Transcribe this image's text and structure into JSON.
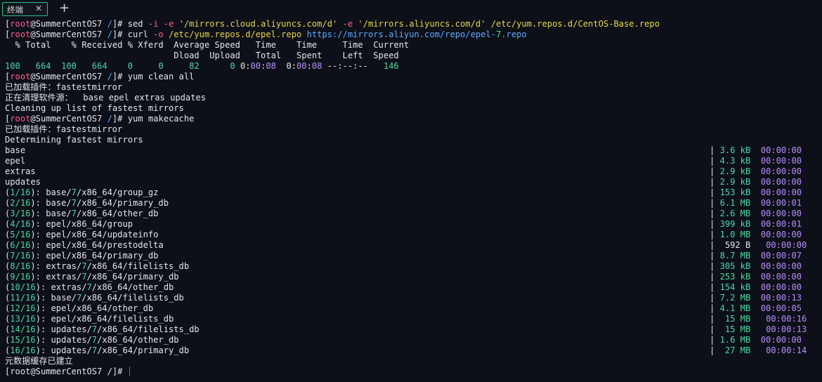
{
  "tab": {
    "title": "终端",
    "close_glyph": "✕",
    "new_tab_glyph": "+"
  },
  "colors": {
    "background": "#0d1018",
    "tab_border": "#2ec27e",
    "prompt_bracket": "#ff5c8a",
    "path": "#5ea8ff",
    "string": "#e8d44d",
    "number": "#4fd6a2",
    "time": "#b98cff",
    "cursor": "#e0406a"
  },
  "terminal": {
    "lines": [
      {
        "segs": [
          [
            "[",
            "d"
          ],
          [
            "root",
            "r"
          ],
          [
            "@SummerCentOS7 ",
            "d"
          ],
          [
            "/",
            "b"
          ],
          [
            "]# ",
            "d"
          ],
          [
            "sed ",
            "d"
          ],
          [
            "-i -e ",
            "r"
          ],
          [
            "'/mirrors.cloud.aliyuncs.com/d'",
            "y"
          ],
          [
            " ",
            "d"
          ],
          [
            "-e ",
            "r"
          ],
          [
            "'/mirrors.aliyuncs.com/d'",
            "y"
          ],
          [
            " ",
            "d"
          ],
          [
            "/etc/yum.repos.d/CentOS-Base.repo",
            "y"
          ]
        ]
      },
      {
        "segs": [
          [
            "[",
            "d"
          ],
          [
            "root",
            "r"
          ],
          [
            "@SummerCentOS7 ",
            "d"
          ],
          [
            "/",
            "b"
          ],
          [
            "]# ",
            "d"
          ],
          [
            "curl ",
            "d"
          ],
          [
            "-o ",
            "r"
          ],
          [
            "/etc/yum.repos.d/epel.repo",
            "y"
          ],
          [
            " ",
            "d"
          ],
          [
            "https://mirrors.aliyun.com/repo/epel-",
            "b"
          ],
          [
            "7",
            "g"
          ],
          [
            ".repo",
            "b"
          ]
        ]
      },
      {
        "segs": [
          [
            "  % Total    % Received % Xferd  Average Speed   Time    Time     Time  Current",
            "d"
          ]
        ]
      },
      {
        "segs": [
          [
            "                                 Dload  Upload   Total   Spent    Left  Speed",
            "d"
          ]
        ]
      },
      {
        "segs": [
          [
            "100   664  100   664    0     0     82      0 ",
            "g"
          ],
          [
            "0",
            "d"
          ],
          [
            ":",
            "d"
          ],
          [
            "00",
            "p"
          ],
          [
            ":",
            "d"
          ],
          [
            "08",
            "p"
          ],
          [
            "  ",
            "d"
          ],
          [
            "0",
            "d"
          ],
          [
            ":",
            "d"
          ],
          [
            "00",
            "p"
          ],
          [
            ":",
            "d"
          ],
          [
            "08",
            "p"
          ],
          [
            " --:--:--   ",
            "d"
          ],
          [
            "146",
            "g"
          ]
        ]
      },
      {
        "segs": [
          [
            "[",
            "d"
          ],
          [
            "root",
            "r"
          ],
          [
            "@SummerCentOS7 ",
            "d"
          ],
          [
            "/",
            "b"
          ],
          [
            "]# ",
            "d"
          ],
          [
            "yum clean all",
            "d"
          ]
        ]
      },
      {
        "segs": [
          [
            "已加载插件：fastestmirror",
            "d"
          ]
        ]
      },
      {
        "segs": [
          [
            "正在清理软件源：  base epel extras updates",
            "d"
          ]
        ]
      },
      {
        "segs": [
          [
            "Cleaning up list of fastest mirrors",
            "d"
          ]
        ]
      },
      {
        "segs": [
          [
            "[",
            "d"
          ],
          [
            "root",
            "r"
          ],
          [
            "@SummerCentOS7 ",
            "d"
          ],
          [
            "/",
            "b"
          ],
          [
            "]# ",
            "d"
          ],
          [
            "yum makecache",
            "d"
          ]
        ]
      },
      {
        "segs": [
          [
            "已加载插件：fastestmirror",
            "d"
          ]
        ]
      },
      {
        "segs": [
          [
            "Determining fastest mirrors",
            "d"
          ]
        ]
      },
      {
        "segs": [
          [
            "base",
            "d"
          ]
        ],
        "right": [
          [
            "| ",
            "d"
          ],
          [
            "3.6 kB",
            "g"
          ],
          [
            "  ",
            "d"
          ],
          [
            "00:00:00",
            "p"
          ]
        ]
      },
      {
        "segs": [
          [
            "epel",
            "d"
          ]
        ],
        "right": [
          [
            "| ",
            "d"
          ],
          [
            "4.3 kB",
            "g"
          ],
          [
            "  ",
            "d"
          ],
          [
            "00:00:00",
            "p"
          ]
        ]
      },
      {
        "segs": [
          [
            "extras",
            "d"
          ]
        ],
        "right": [
          [
            "| ",
            "d"
          ],
          [
            "2.9 kB",
            "g"
          ],
          [
            "  ",
            "d"
          ],
          [
            "00:00:00",
            "p"
          ]
        ]
      },
      {
        "segs": [
          [
            "updates",
            "d"
          ]
        ],
        "right": [
          [
            "| ",
            "d"
          ],
          [
            "2.9 kB",
            "g"
          ],
          [
            "  ",
            "d"
          ],
          [
            "00:00:00",
            "p"
          ]
        ]
      },
      {
        "segs": [
          [
            "(",
            "d"
          ],
          [
            "1/16",
            "g"
          ],
          [
            "): base/",
            "d"
          ],
          [
            "7",
            "g"
          ],
          [
            "/x86_64/group_gz",
            "d"
          ]
        ],
        "right": [
          [
            "| ",
            "d"
          ],
          [
            "153 kB",
            "g"
          ],
          [
            "  ",
            "d"
          ],
          [
            "00:00:00",
            "p"
          ]
        ]
      },
      {
        "segs": [
          [
            "(",
            "d"
          ],
          [
            "2/16",
            "g"
          ],
          [
            "): base/",
            "d"
          ],
          [
            "7",
            "g"
          ],
          [
            "/x86_64/primary_db",
            "d"
          ]
        ],
        "right": [
          [
            "| ",
            "d"
          ],
          [
            "6.1 MB",
            "g"
          ],
          [
            "  ",
            "d"
          ],
          [
            "00:00:01",
            "p"
          ]
        ]
      },
      {
        "segs": [
          [
            "(",
            "d"
          ],
          [
            "3/16",
            "g"
          ],
          [
            "): base/",
            "d"
          ],
          [
            "7",
            "g"
          ],
          [
            "/x86_64/other_db",
            "d"
          ]
        ],
        "right": [
          [
            "| ",
            "d"
          ],
          [
            "2.6 MB",
            "g"
          ],
          [
            "  ",
            "d"
          ],
          [
            "00:00:00",
            "p"
          ]
        ]
      },
      {
        "segs": [
          [
            "(",
            "d"
          ],
          [
            "4/16",
            "g"
          ],
          [
            "): epel/x86_64/group",
            "d"
          ]
        ],
        "right": [
          [
            "| ",
            "d"
          ],
          [
            "399 kB",
            "g"
          ],
          [
            "  ",
            "d"
          ],
          [
            "00:00:01",
            "p"
          ]
        ]
      },
      {
        "segs": [
          [
            "(",
            "d"
          ],
          [
            "5/16",
            "g"
          ],
          [
            "): epel/x86_64/updateinfo",
            "d"
          ]
        ],
        "right": [
          [
            "| ",
            "d"
          ],
          [
            "1.0 MB",
            "g"
          ],
          [
            "  ",
            "d"
          ],
          [
            "00:00:00",
            "p"
          ]
        ]
      },
      {
        "segs": [
          [
            "(",
            "d"
          ],
          [
            "6/16",
            "g"
          ],
          [
            "): epel/x86_64/prestodelta",
            "d"
          ]
        ],
        "right": [
          [
            "|  ",
            "d"
          ],
          [
            "592 B ",
            "d"
          ],
          [
            "  ",
            "d"
          ],
          [
            "00:00:00",
            "p"
          ]
        ]
      },
      {
        "segs": [
          [
            "(",
            "d"
          ],
          [
            "7/16",
            "g"
          ],
          [
            "): epel/x86_64/primary_db",
            "d"
          ]
        ],
        "right": [
          [
            "| ",
            "d"
          ],
          [
            "8.7 MB",
            "g"
          ],
          [
            "  ",
            "d"
          ],
          [
            "00:00:07",
            "p"
          ]
        ]
      },
      {
        "segs": [
          [
            "(",
            "d"
          ],
          [
            "8/16",
            "g"
          ],
          [
            "): extras/",
            "d"
          ],
          [
            "7",
            "g"
          ],
          [
            "/x86_64/filelists_db",
            "d"
          ]
        ],
        "right": [
          [
            "| ",
            "d"
          ],
          [
            "305 kB",
            "g"
          ],
          [
            "  ",
            "d"
          ],
          [
            "00:00:00",
            "p"
          ]
        ]
      },
      {
        "segs": [
          [
            "(",
            "d"
          ],
          [
            "9/16",
            "g"
          ],
          [
            "): extras/",
            "d"
          ],
          [
            "7",
            "g"
          ],
          [
            "/x86_64/primary_db",
            "d"
          ]
        ],
        "right": [
          [
            "| ",
            "d"
          ],
          [
            "253 kB",
            "g"
          ],
          [
            "  ",
            "d"
          ],
          [
            "00:00:00",
            "p"
          ]
        ]
      },
      {
        "segs": [
          [
            "(",
            "d"
          ],
          [
            "10/16",
            "g"
          ],
          [
            "): extras/",
            "d"
          ],
          [
            "7",
            "g"
          ],
          [
            "/x86_64/other_db",
            "d"
          ]
        ],
        "right": [
          [
            "| ",
            "d"
          ],
          [
            "154 kB",
            "g"
          ],
          [
            "  ",
            "d"
          ],
          [
            "00:00:00",
            "p"
          ]
        ]
      },
      {
        "segs": [
          [
            "(",
            "d"
          ],
          [
            "11/16",
            "g"
          ],
          [
            "): base/",
            "d"
          ],
          [
            "7",
            "g"
          ],
          [
            "/x86_64/filelists_db",
            "d"
          ]
        ],
        "right": [
          [
            "| ",
            "d"
          ],
          [
            "7.2 MB",
            "g"
          ],
          [
            "  ",
            "d"
          ],
          [
            "00:00:13",
            "p"
          ]
        ]
      },
      {
        "segs": [
          [
            "(",
            "d"
          ],
          [
            "12/16",
            "g"
          ],
          [
            "): epel/x86_64/other_db",
            "d"
          ]
        ],
        "right": [
          [
            "| ",
            "d"
          ],
          [
            "4.1 MB",
            "g"
          ],
          [
            "  ",
            "d"
          ],
          [
            "00:00:05",
            "p"
          ]
        ]
      },
      {
        "segs": [
          [
            "(",
            "d"
          ],
          [
            "13/16",
            "g"
          ],
          [
            "): epel/x86_64/filelists_db",
            "d"
          ]
        ],
        "right": [
          [
            "|  ",
            "d"
          ],
          [
            "15 MB",
            "g"
          ],
          [
            "   ",
            "d"
          ],
          [
            "00:00:16",
            "p"
          ]
        ]
      },
      {
        "segs": [
          [
            "(",
            "d"
          ],
          [
            "14/16",
            "g"
          ],
          [
            "): updates/",
            "d"
          ],
          [
            "7",
            "g"
          ],
          [
            "/x86_64/filelists_db",
            "d"
          ]
        ],
        "right": [
          [
            "|  ",
            "d"
          ],
          [
            "15 MB",
            "g"
          ],
          [
            "   ",
            "d"
          ],
          [
            "00:00:13",
            "p"
          ]
        ]
      },
      {
        "segs": [
          [
            "(",
            "d"
          ],
          [
            "15/16",
            "g"
          ],
          [
            "): updates/",
            "d"
          ],
          [
            "7",
            "g"
          ],
          [
            "/x86_64/other_db",
            "d"
          ]
        ],
        "right": [
          [
            "| ",
            "d"
          ],
          [
            "1.6 MB",
            "g"
          ],
          [
            "  ",
            "d"
          ],
          [
            "00:00:00",
            "p"
          ]
        ]
      },
      {
        "segs": [
          [
            "(",
            "d"
          ],
          [
            "16/16",
            "g"
          ],
          [
            "): updates/",
            "d"
          ],
          [
            "7",
            "g"
          ],
          [
            "/x86_64/primary_db",
            "d"
          ]
        ],
        "right": [
          [
            "|  ",
            "d"
          ],
          [
            "27 MB",
            "g"
          ],
          [
            "   ",
            "d"
          ],
          [
            "00:00:14",
            "p"
          ]
        ]
      },
      {
        "segs": [
          [
            "元数据缓存已建立",
            "d"
          ]
        ]
      },
      {
        "segs": [
          [
            "[root@SummerCentOS7 /]# ",
            "d"
          ]
        ],
        "cursor": true
      }
    ]
  }
}
